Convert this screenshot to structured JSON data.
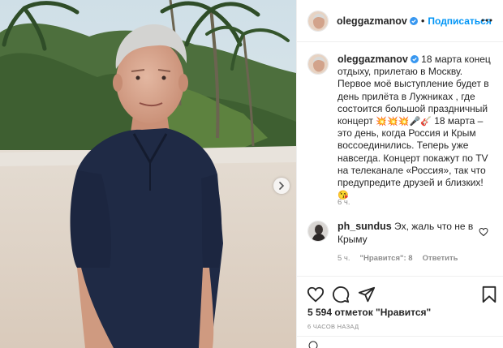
{
  "post": {
    "username": "oleggazmanov",
    "follow_label": "Подписаться",
    "dot": "•"
  },
  "caption": {
    "username": "oleggazmanov",
    "text_part1": "18 марта конец отдыху, прилетаю в Москву. Первое моё выступление будет в день прилёта в Лужниках , где состоится большой праздничный концерт",
    "emojis": "💥💥💥🎤🎸",
    "text_part2": "18 марта – это день, когда Россия и Крым воссоединились. Теперь уже навсегда. Концерт покажут по TV на телеканале «Россия», так что предупредите друзей и близких!",
    "end_emoji": "😘",
    "time": "6 ч."
  },
  "comment": {
    "username": "ph_sundus",
    "text": "Эх, жаль что не в Крыму",
    "time": "5 ч.",
    "likes_label": "\"Нравится\": 8",
    "reply_label": "Ответить"
  },
  "footer": {
    "likes": "5 594 отметок \"Нравится\"",
    "posted": "6 ЧАСОВ НАЗАД"
  },
  "icons": {
    "verified": "verified-badge-icon",
    "more": "more-options-icon",
    "next": "chevron-right-icon",
    "like": "heart-icon",
    "comment": "comment-bubble-icon",
    "share": "paper-plane-icon",
    "save": "bookmark-icon",
    "emoji": "smiley-icon"
  },
  "colors": {
    "accent": "#0095f6",
    "text": "#262626",
    "muted": "#8e8e8e",
    "border": "#efefef"
  }
}
